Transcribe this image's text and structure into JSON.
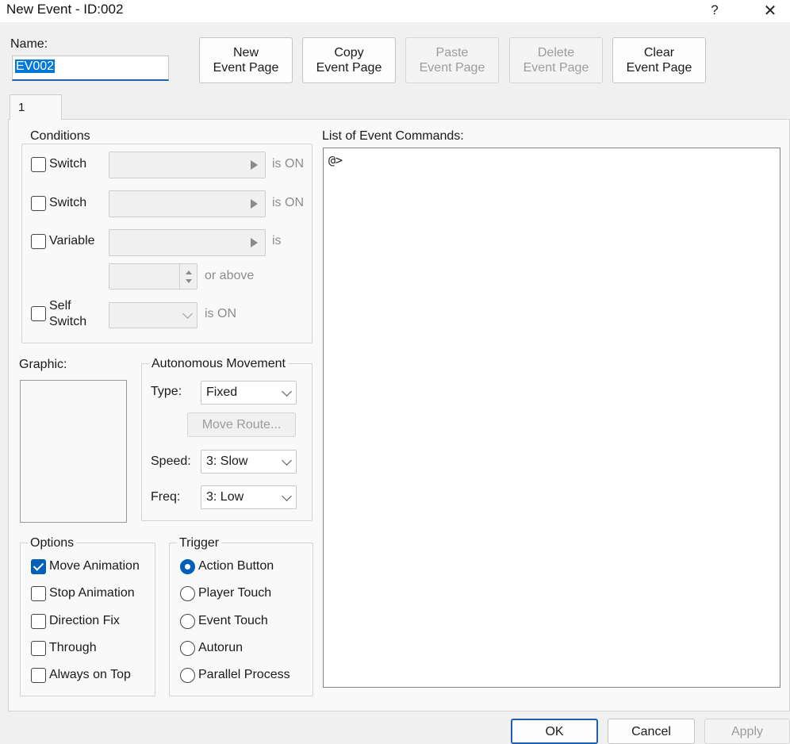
{
  "window": {
    "title": "New Event - ID:002",
    "help_label": "?",
    "close_label": "✕"
  },
  "name": {
    "label": "Name:",
    "value": "EV002"
  },
  "page_buttons": {
    "new": [
      "New",
      "Event Page"
    ],
    "copy": [
      "Copy",
      "Event Page"
    ],
    "paste": [
      "Paste",
      "Event Page"
    ],
    "delete": [
      "Delete",
      "Event Page"
    ],
    "clear": [
      "Clear",
      "Event Page"
    ]
  },
  "tabs": [
    {
      "label": "1"
    }
  ],
  "conditions": {
    "title": "Conditions",
    "switch1": {
      "label": "Switch",
      "suffix": "is ON",
      "checked": false
    },
    "switch2": {
      "label": "Switch",
      "suffix": "is ON",
      "checked": false
    },
    "variable": {
      "label": "Variable",
      "suffix": "is",
      "or_above": "or above",
      "checked": false
    },
    "self_switch": {
      "label_line1": "Self",
      "label_line2": "Switch",
      "suffix": "is ON",
      "checked": false
    }
  },
  "graphic": {
    "label": "Graphic:"
  },
  "movement": {
    "title": "Autonomous Movement",
    "type_label": "Type:",
    "type_value": "Fixed",
    "move_route_label": "Move Route...",
    "speed_label": "Speed:",
    "speed_value": "3: Slow",
    "freq_label": "Freq:",
    "freq_value": "3: Low"
  },
  "options": {
    "title": "Options",
    "items": [
      {
        "label": "Move Animation",
        "checked": true
      },
      {
        "label": "Stop Animation",
        "checked": false
      },
      {
        "label": "Direction Fix",
        "checked": false
      },
      {
        "label": "Through",
        "checked": false
      },
      {
        "label": "Always on Top",
        "checked": false
      }
    ]
  },
  "trigger": {
    "title": "Trigger",
    "items": [
      {
        "label": "Action Button",
        "selected": true
      },
      {
        "label": "Player Touch",
        "selected": false
      },
      {
        "label": "Event Touch",
        "selected": false
      },
      {
        "label": "Autorun",
        "selected": false
      },
      {
        "label": "Parallel Process",
        "selected": false
      }
    ]
  },
  "commands": {
    "label": "List of Event Commands:",
    "lines": [
      "@>"
    ]
  },
  "footer": {
    "ok": "OK",
    "cancel": "Cancel",
    "apply": "Apply"
  },
  "colors": {
    "accent": "#005fb8",
    "selection": "#0078d7"
  }
}
